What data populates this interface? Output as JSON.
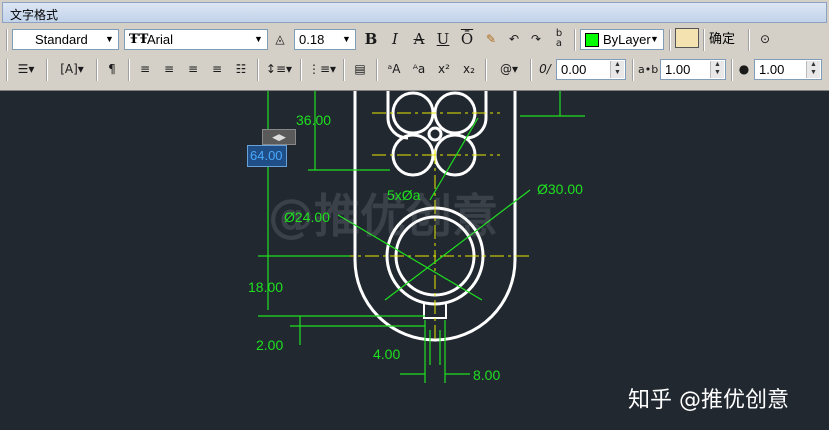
{
  "window": {
    "title": "文字格式"
  },
  "toolbar": {
    "style_value": "Standard",
    "font_value": "Arial",
    "height_value": "0.18",
    "bold_label": "B",
    "italic_label": "I",
    "strike_label": "A",
    "underline_label": "U",
    "overline_label": "Ō",
    "color_value": "ByLayer",
    "ok_label": "确定",
    "oblique_value": "0.00",
    "tracking_value": "1.00",
    "width_factor_value": "1.00",
    "color_swatch": "#00ff00"
  },
  "cad": {
    "edit_value": "64.00",
    "dimensions": {
      "d1": "36.00",
      "d2": "5xØa",
      "d3": "Ø30.00",
      "d4": "Ø24.00",
      "d5": "18.00",
      "d6": "2.00",
      "d7": "4.00",
      "d8": "8.00"
    },
    "line_color": "#1fe01f",
    "geometry_color": "#ffffff",
    "centerline_color": "#e8e800"
  },
  "watermark": "@推优创意",
  "brand": "知乎 @推优创意"
}
